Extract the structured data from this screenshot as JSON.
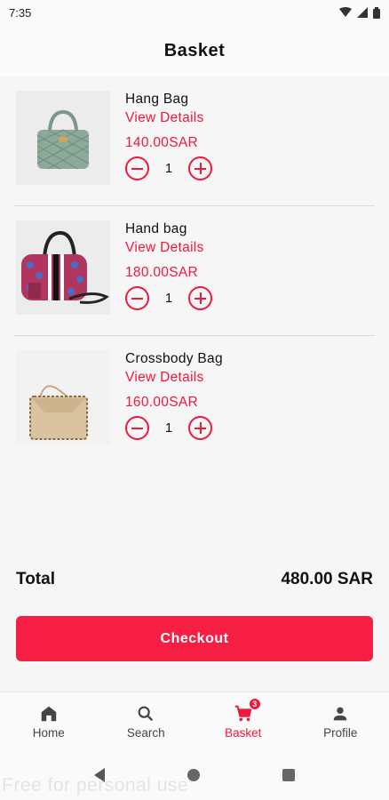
{
  "status_bar": {
    "time": "7:35"
  },
  "header": {
    "title": "Basket"
  },
  "items": [
    {
      "name": "Hang Bag",
      "details_label": "View Details",
      "price": "140.00SAR",
      "quantity": "1"
    },
    {
      "name": "Hand bag",
      "details_label": "View Details",
      "price": "180.00SAR",
      "quantity": "1"
    },
    {
      "name": "Crossbody Bag",
      "details_label": "View Details",
      "price": "160.00SAR",
      "quantity": "1"
    }
  ],
  "summary": {
    "total_label": "Total",
    "total_value": "480.00 SAR"
  },
  "checkout_label": "Checkout",
  "bottom_nav": {
    "home": "Home",
    "search": "Search",
    "basket": "Basket",
    "basket_badge": "3",
    "profile": "Profile"
  },
  "watermark": "Free for personal use",
  "colors": {
    "accent": "#f0183c",
    "checkout_bg": "#f71e43"
  }
}
